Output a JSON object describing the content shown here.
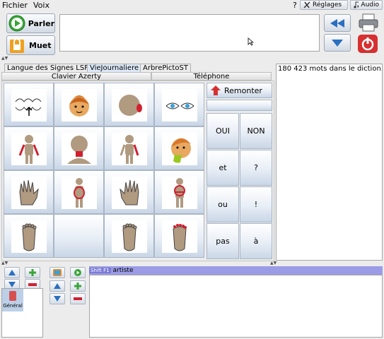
{
  "menu": {
    "file": "Fichier",
    "voice": "Voix",
    "help": "?"
  },
  "top_buttons": {
    "settings": "Réglages",
    "audio": "Audio"
  },
  "speech": {
    "speak": "Parler",
    "mute": "Muet",
    "text": ""
  },
  "tabs": [
    {
      "label": "Langue des Signes LSF",
      "active": false
    },
    {
      "label": "VieJournaliere",
      "active": true
    },
    {
      "label": "ArbrePictoST",
      "active": false
    }
  ],
  "subheaders": {
    "keyboard": "Clavier Azerty",
    "phone": "Téléphone"
  },
  "pictograms": [
    {
      "icon": "teeth-icon"
    },
    {
      "icon": "face-icon"
    },
    {
      "icon": "ear-icon"
    },
    {
      "icon": "eyes-icon"
    },
    {
      "icon": "body-arms-icon"
    },
    {
      "icon": "neck-icon"
    },
    {
      "icon": "body-side-icon"
    },
    {
      "icon": "sick-face-icon"
    },
    {
      "icon": "hand-left-icon"
    },
    {
      "icon": "belly-icon"
    },
    {
      "icon": "hand-right-icon"
    },
    {
      "icon": "belly-front-icon"
    },
    {
      "icon": "foot-left-icon"
    },
    {
      "icon": "empty"
    },
    {
      "icon": "foot-right-icon"
    },
    {
      "icon": "toes-icon"
    }
  ],
  "words": {
    "back": "Remonter",
    "items": [
      "OUI",
      "NON",
      "et",
      "?",
      "ou",
      "!",
      "pas",
      "à"
    ]
  },
  "dictionary": {
    "status": "180 423 mots dans le diction..."
  },
  "shift": {
    "key": "Shift F1",
    "word": "artiste"
  },
  "category": {
    "label": "Général"
  },
  "colors": {
    "accent": "#2a6fc0",
    "speak_green": "#3aa53a",
    "mute_orange": "#f0a020",
    "power_red": "#d63030"
  }
}
